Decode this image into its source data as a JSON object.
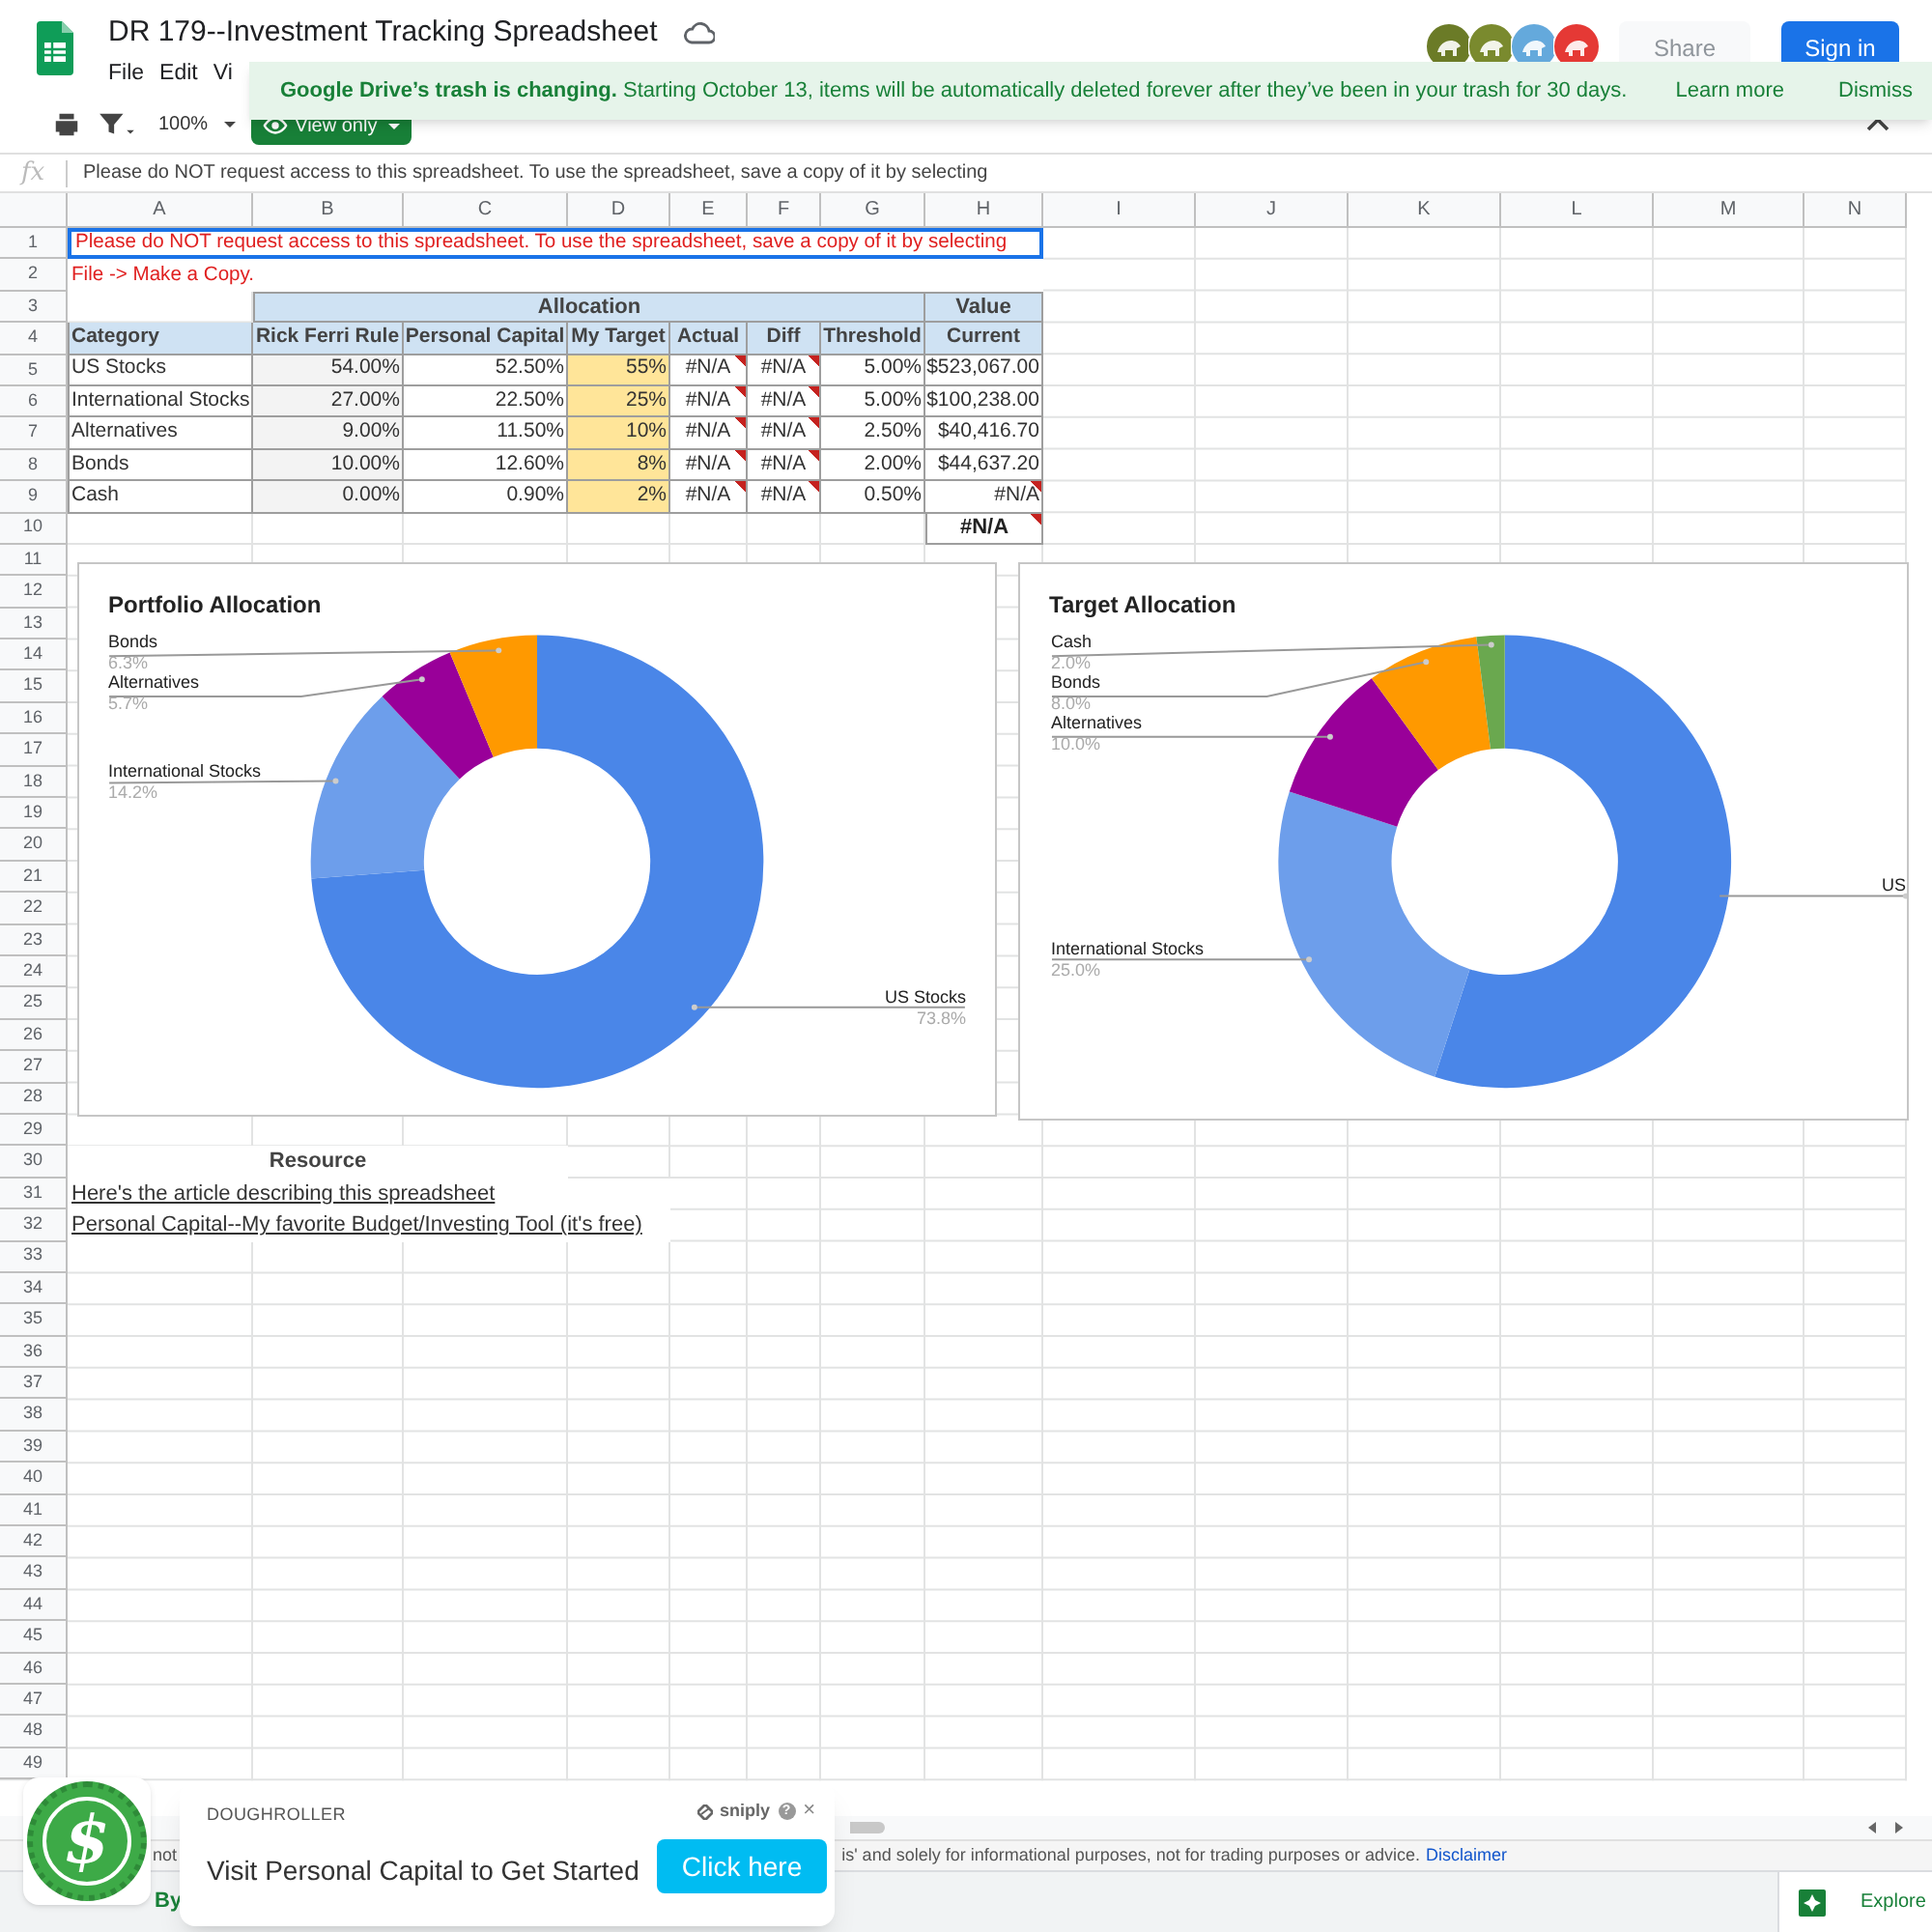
{
  "app": {
    "title": "DR 179--Investment Tracking Spreadsheet",
    "menu": [
      "File",
      "Edit",
      "Vi"
    ],
    "share": {
      "label": "Share",
      "disabled": true
    },
    "sign_in": "Sign in"
  },
  "banner": {
    "text": "**Google Drive’s trash is changing.** Starting October 13, items will be automatically deleted forever after they’ve been in your trash for 30 days.",
    "learn_more": "Learn more",
    "dismiss": "Dismiss"
  },
  "toolbar": {
    "zoom": "100%",
    "mode": "View only"
  },
  "formula_bar": {
    "fx": "fx",
    "text": "Please do NOT request access to this spreadsheet. To use the spreadsheet, save a copy of it by selecting"
  },
  "sheet": {
    "columns": [
      "A",
      "B",
      "C",
      "D",
      "E",
      "F",
      "G",
      "H",
      "I",
      "J",
      "K",
      "L",
      "M",
      "N"
    ],
    "row_numbers": [
      "1",
      "2",
      "3",
      "4",
      "5",
      "6",
      "7",
      "8",
      "9",
      "10",
      "11",
      "12",
      "13",
      "14",
      "15",
      "16",
      "17",
      "18",
      "19",
      "20",
      "21",
      "22",
      "23",
      "24",
      "25",
      "26",
      "27",
      "28",
      "29",
      "30",
      "31",
      "32",
      "33",
      "34",
      "35",
      "36",
      "37",
      "38",
      "39",
      "40",
      "41",
      "42",
      "43",
      "44",
      "45",
      "46",
      "47",
      "48",
      "49"
    ],
    "notice": {
      "lines": [
        "Please do NOT request access to this spreadsheet. To use the spreadsheet, save a copy of it by selecting",
        "File -> Make a Copy."
      ],
      "selected": true
    },
    "allocation": {
      "group_header": "Allocation",
      "value_header": "Value",
      "headers": [
        "Category",
        "Rick Ferri Rule",
        "Personal Capital",
        "My Target",
        "Actual",
        "Diff",
        "Threshold",
        "Current"
      ],
      "rows": [
        {
          "cells": [
            {
              "text": "US Stocks",
              "note": false
            },
            {
              "text": "54.00%",
              "note": false
            },
            {
              "text": "52.50%",
              "note": false
            },
            {
              "text": "55%",
              "note": false
            },
            {
              "text": "#N/A",
              "note": true
            },
            {
              "text": "#N/A",
              "note": true
            },
            {
              "text": "5.00%",
              "note": false
            },
            {
              "text": "$523,067.00",
              "note": false
            }
          ]
        },
        {
          "cells": [
            {
              "text": "International Stocks",
              "note": false
            },
            {
              "text": "27.00%",
              "note": false
            },
            {
              "text": "22.50%",
              "note": false
            },
            {
              "text": "25%",
              "note": false
            },
            {
              "text": "#N/A",
              "note": true
            },
            {
              "text": "#N/A",
              "note": true
            },
            {
              "text": "5.00%",
              "note": false
            },
            {
              "text": "$100,238.00",
              "note": false
            }
          ]
        },
        {
          "cells": [
            {
              "text": "Alternatives",
              "note": false
            },
            {
              "text": "9.00%",
              "note": false
            },
            {
              "text": "11.50%",
              "note": false
            },
            {
              "text": "10%",
              "note": false
            },
            {
              "text": "#N/A",
              "note": true
            },
            {
              "text": "#N/A",
              "note": true
            },
            {
              "text": "2.50%",
              "note": false
            },
            {
              "text": "$40,416.70",
              "note": false
            }
          ]
        },
        {
          "cells": [
            {
              "text": "Bonds",
              "note": false
            },
            {
              "text": "10.00%",
              "note": false
            },
            {
              "text": "12.60%",
              "note": false
            },
            {
              "text": "8%",
              "note": false
            },
            {
              "text": "#N/A",
              "note": true
            },
            {
              "text": "#N/A",
              "note": true
            },
            {
              "text": "2.00%",
              "note": false
            },
            {
              "text": "$44,637.20",
              "note": false
            }
          ]
        },
        {
          "cells": [
            {
              "text": "Cash",
              "note": false
            },
            {
              "text": "0.00%",
              "note": false
            },
            {
              "text": "0.90%",
              "note": false
            },
            {
              "text": "2%",
              "note": false
            },
            {
              "text": "#N/A",
              "note": true
            },
            {
              "text": "#N/A",
              "note": true
            },
            {
              "text": "0.50%",
              "note": false
            },
            {
              "text": "#N/A",
              "note": true
            }
          ]
        }
      ],
      "total": {
        "text": "#N/A",
        "note": true
      }
    },
    "resource": {
      "heading": "Resource",
      "links": [
        "Here's the article describing this spreadsheet",
        "Personal Capital--My favorite Budget/Investing Tool (it's free)"
      ]
    }
  },
  "charts": [
    {
      "chart_data": {
        "type": "donut",
        "title": "Portfolio Allocation",
        "categories": [
          "US Stocks",
          "International Stocks",
          "Alternatives",
          "Bonds"
        ],
        "values": [
          73.8,
          14.2,
          5.7,
          6.3
        ],
        "colors": [
          "#4a86e8",
          "#6d9eeb",
          "#990099",
          "#ff9900"
        ],
        "value_labels": [
          "73.8%",
          "14.2%",
          "5.7%",
          "6.3%"
        ]
      }
    },
    {
      "chart_data": {
        "type": "donut",
        "title": "Target Allocation",
        "categories": [
          "US",
          "International Stocks",
          "Alternatives",
          "Bonds",
          "Cash"
        ],
        "values": [
          55,
          25,
          10,
          8,
          2
        ],
        "colors": [
          "#4a86e8",
          "#6d9eeb",
          "#990099",
          "#ff9900",
          "#6aa84f"
        ],
        "value_labels": [
          null,
          "25.0%",
          "10.0%",
          "8.0%",
          "2.0%"
        ]
      }
    }
  ],
  "disclaimer": {
    "before": "not",
    "after": "is' and solely for informational purposes, not for trading purposes or advice.",
    "link": "Disclaimer"
  },
  "sheet_tabs": {
    "byline": "By",
    "explore": "Explore"
  },
  "promo": {
    "logo": "$",
    "publisher": "DOUGHROLLER",
    "brand": "sniply",
    "help": "?",
    "close": "×",
    "message": "Visit Personal Capital to Get Started",
    "button": "Click here"
  }
}
